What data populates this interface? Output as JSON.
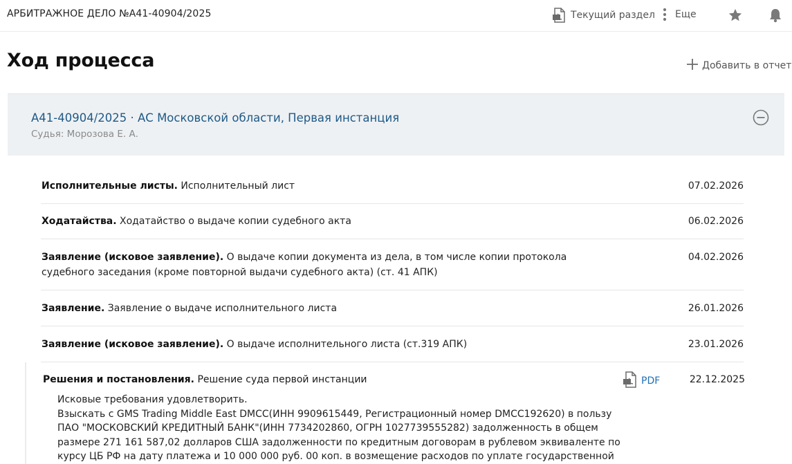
{
  "header": {
    "case_number": "АРБИТРАЖНОЕ ДЕЛО №А41-40904/2025",
    "current_section_label": "Текущий раздел",
    "current_section_icon": "pdf-icon",
    "more_label": "Еще",
    "more_icon": "kebab-icon",
    "favorite_icon": "star-icon",
    "notifications_icon": "bell-icon"
  },
  "page": {
    "title": "Ход процесса",
    "add_to_report_label": "Добавить в отчет",
    "add_to_report_icon": "plus-icon"
  },
  "instance": {
    "title": "А41-40904/2025 · АС Московской области, Первая инстанция",
    "judge": "Судья: Морозова Е. А.",
    "collapse_icon": "minus-circle-icon",
    "accent_color": "#1f5a86"
  },
  "events": [
    {
      "kind": "Исполнительные листы.",
      "text": " Исполнительный лист",
      "date": "07.02.2026"
    },
    {
      "kind": "Ходатайства.",
      "text": " Ходатайство о выдаче копии судебного акта",
      "date": "06.02.2026"
    },
    {
      "kind": "Заявление (исковое заявление).",
      "text": " О выдаче копии документа из дела, в том числе копии протокола судебного заседания (кроме повторной выдачи судебного акта) (ст. 41 АПК)",
      "date": "04.02.2026"
    },
    {
      "kind": "Заявление.",
      "text": " Заявление о выдаче исполнительного листа",
      "date": "26.01.2026"
    },
    {
      "kind": "Заявление (исковое заявление).",
      "text": " О выдаче исполнительного листа (ст.319 АПК)",
      "date": "23.01.2026"
    }
  ],
  "decision": {
    "kind": "Решения и постановления.",
    "text": " Решение суда первой инстанции",
    "pdf_label": "PDF",
    "pdf_icon": "pdf-icon",
    "date": "22.12.2025",
    "body_line1": "Исковые требования удовлетворить.",
    "body_line2": "Взыскать с GMS Trading Middle East DMCC(ИНН 9909615449, Регистрационный номер DMCC192620) в пользу ПАО \"МОСКОВСКИЙ КРЕДИТНЫЙ БАНК\"(ИНН 7734202860, ОГРН 1027739555282) задолженность в общем размере 271 161 587,02 долларов США задолженности по кредитным договорам в рублевом эквиваленте по курсу ЦБ РФ на дату платежа и 10 000 000 руб. 00 коп. в возмещение расходов по уплате государственной пошлины."
  }
}
